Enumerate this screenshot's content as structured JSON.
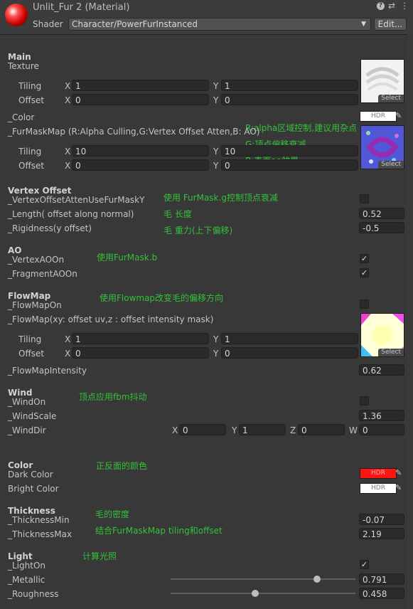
{
  "header": {
    "title": "Unlit_Fur 2 (Material)",
    "shader_label": "Shader",
    "shader_value": "Character/PowerFurInstanced",
    "edit_label": "Edit..."
  },
  "common": {
    "x": "X",
    "y": "Y",
    "z": "Z",
    "w": "W",
    "tiling": "Tiling",
    "offset": "Offset",
    "select": "Select",
    "hdr": "HDR"
  },
  "main": {
    "section": "Main",
    "texture_label": "Texture",
    "tiling_x": "1",
    "tiling_y": "1",
    "offset_x": "0",
    "offset_y": "0",
    "color_label": "_Color",
    "furmask_label": "_FurMaskMap (R:Alpha Culling,G:Vertex Offset Atten,B: AO)",
    "furmask_tiling_x": "10",
    "furmask_tiling_y": "10",
    "furmask_offset_x": "0",
    "furmask_offset_y": "0",
    "note_r": "R:alpha区域控制,建议用杂点",
    "note_g": "G:顶点偏移衰减",
    "note_b": "B:表面ao效果"
  },
  "vertex_offset": {
    "section": "Vertex Offset",
    "atten_label": "_VertexOffsetAttenUseFurMaskY",
    "atten_note": "使用 FurMask.g控制顶点衰减",
    "length_label": "_Length( offset along normal)",
    "length_note": "毛 长度",
    "length_value": "0.52",
    "rigidity_label": "_Rigidness(y offset)",
    "rigidity_note": "毛 重力(上下偏移)",
    "rigidity_value": "-0.5"
  },
  "ao": {
    "section": "AO",
    "vertex_label": "_VertexAOOn",
    "note": "使用FurMask.b",
    "fragment_label": "_FragmentAOOn"
  },
  "flowmap": {
    "section": "FlowMap",
    "on_label": "_FlowMapOn",
    "note": "使用Flowmap改变毛的偏移方向",
    "map_label": "_FlowMap(xy: offset uv,z : offset intensity mask)",
    "tiling_x": "1",
    "tiling_y": "1",
    "offset_x": "0",
    "offset_y": "0",
    "intensity_label": "_FlowMapIntensity",
    "intensity_value": "0.62"
  },
  "wind": {
    "section": "Wind",
    "on_label": "_WindOn",
    "note": "顶点应用fbm抖动",
    "scale_label": "_WindScale",
    "scale_value": "1.36",
    "dir_label": "_WindDir",
    "dir_x": "0",
    "dir_y": "1",
    "dir_z": "0",
    "dir_w": "0"
  },
  "color": {
    "section": "Color",
    "dark_label": "Dark Color",
    "note": "正反面的颜色",
    "bright_label": "Bright Color",
    "dark_swatch": "#ff1414",
    "bright_swatch": "#ffffff"
  },
  "thickness": {
    "section": "Thickness",
    "min_label": "_ThicknessMin",
    "min_note": "毛的密度",
    "min_value": "-0.07",
    "max_label": "_ThicknessMax",
    "max_note": "结合FurMaskMap tiling和offset",
    "max_value": "2.19"
  },
  "light": {
    "section": "Light",
    "on_label": "_LightOn",
    "note": "计算光照",
    "metallic_label": "_Metallic",
    "metallic_value": "0.791",
    "roughness_label": "_Roughness",
    "roughness_value": "0.458"
  }
}
